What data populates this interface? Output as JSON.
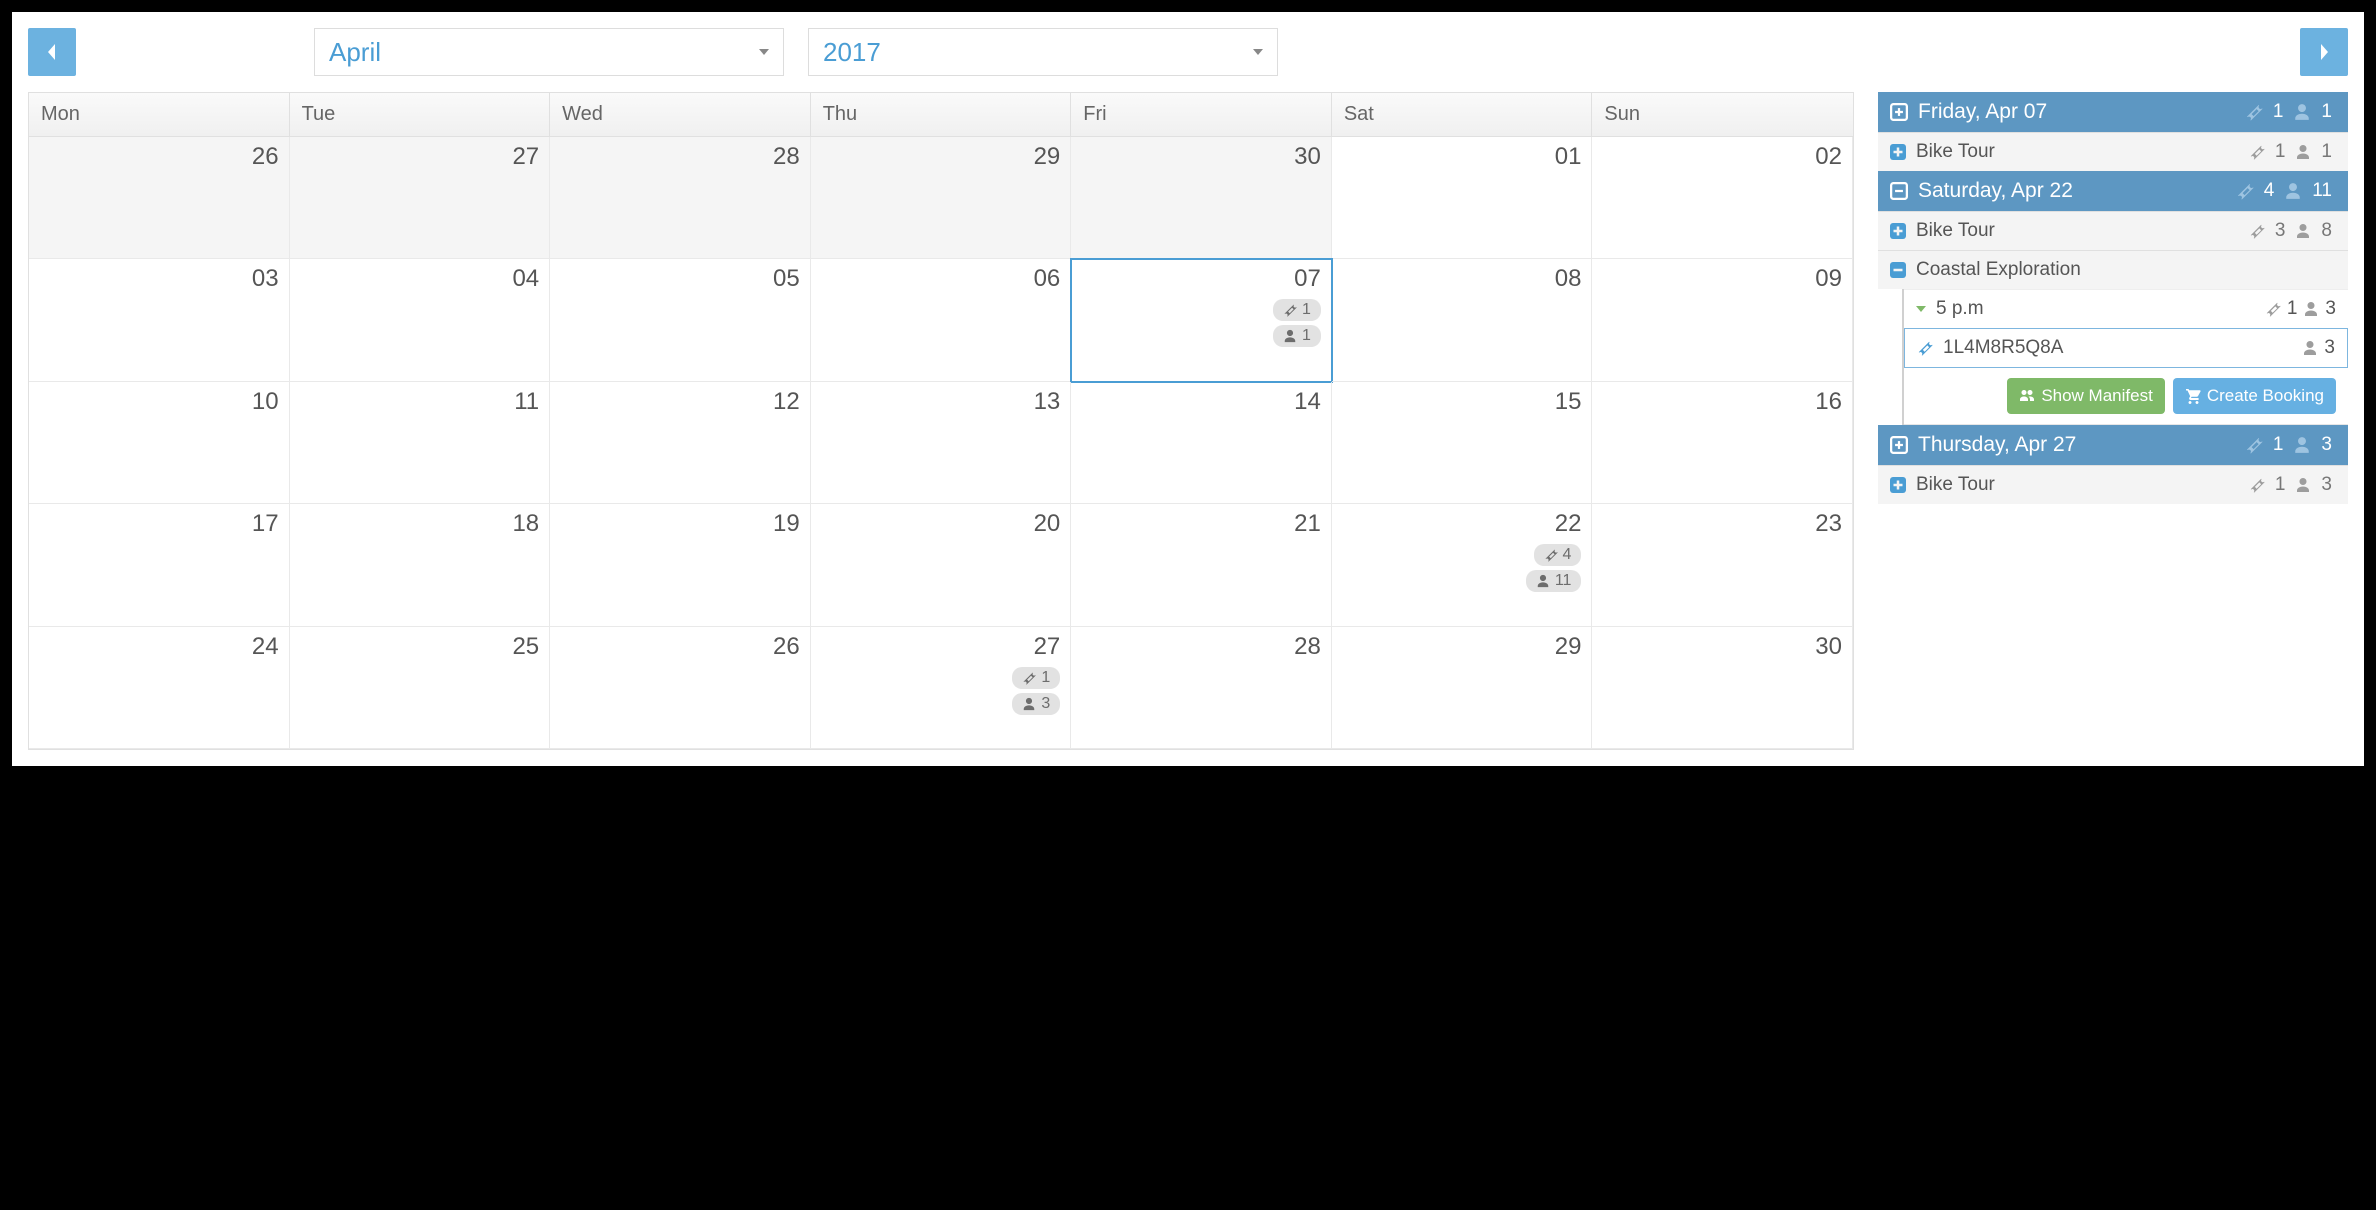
{
  "nav": {
    "month": "April",
    "year": "2017"
  },
  "weekdays": [
    "Mon",
    "Tue",
    "Wed",
    "Thu",
    "Fri",
    "Sat",
    "Sun"
  ],
  "cells": [
    {
      "n": "26",
      "other": true
    },
    {
      "n": "27",
      "other": true
    },
    {
      "n": "28",
      "other": true
    },
    {
      "n": "29",
      "other": true
    },
    {
      "n": "30",
      "other": true
    },
    {
      "n": "01"
    },
    {
      "n": "02"
    },
    {
      "n": "03"
    },
    {
      "n": "04"
    },
    {
      "n": "05"
    },
    {
      "n": "06"
    },
    {
      "n": "07",
      "selected": true,
      "t": "1",
      "p": "1"
    },
    {
      "n": "08"
    },
    {
      "n": "09"
    },
    {
      "n": "10"
    },
    {
      "n": "11"
    },
    {
      "n": "12"
    },
    {
      "n": "13"
    },
    {
      "n": "14"
    },
    {
      "n": "15"
    },
    {
      "n": "16"
    },
    {
      "n": "17"
    },
    {
      "n": "18"
    },
    {
      "n": "19"
    },
    {
      "n": "20"
    },
    {
      "n": "21"
    },
    {
      "n": "22",
      "t": "4",
      "p": "11"
    },
    {
      "n": "23"
    },
    {
      "n": "24"
    },
    {
      "n": "25"
    },
    {
      "n": "26"
    },
    {
      "n": "27",
      "t": "1",
      "p": "3"
    },
    {
      "n": "28"
    },
    {
      "n": "29"
    },
    {
      "n": "30"
    }
  ],
  "side": {
    "d0": {
      "title": "Friday, Apr 07",
      "t": "1",
      "p": "1",
      "r0": {
        "title": "Bike Tour",
        "t": "1",
        "p": "1"
      }
    },
    "d1": {
      "title": "Saturday, Apr 22",
      "t": "4",
      "p": "11",
      "r0": {
        "title": "Bike Tour",
        "t": "3",
        "p": "8"
      },
      "r1": {
        "title": "Coastal Exploration",
        "time": {
          "label": "5 p.m",
          "t": "1",
          "p": "3"
        },
        "bk": {
          "code": "1L4M8R5Q8A",
          "p": "3"
        },
        "btn_manifest": "Show Manifest",
        "btn_create": "Create Booking"
      }
    },
    "d2": {
      "title": "Thursday, Apr 27",
      "t": "1",
      "p": "3",
      "r0": {
        "title": "Bike Tour",
        "t": "1",
        "p": "3"
      }
    }
  }
}
